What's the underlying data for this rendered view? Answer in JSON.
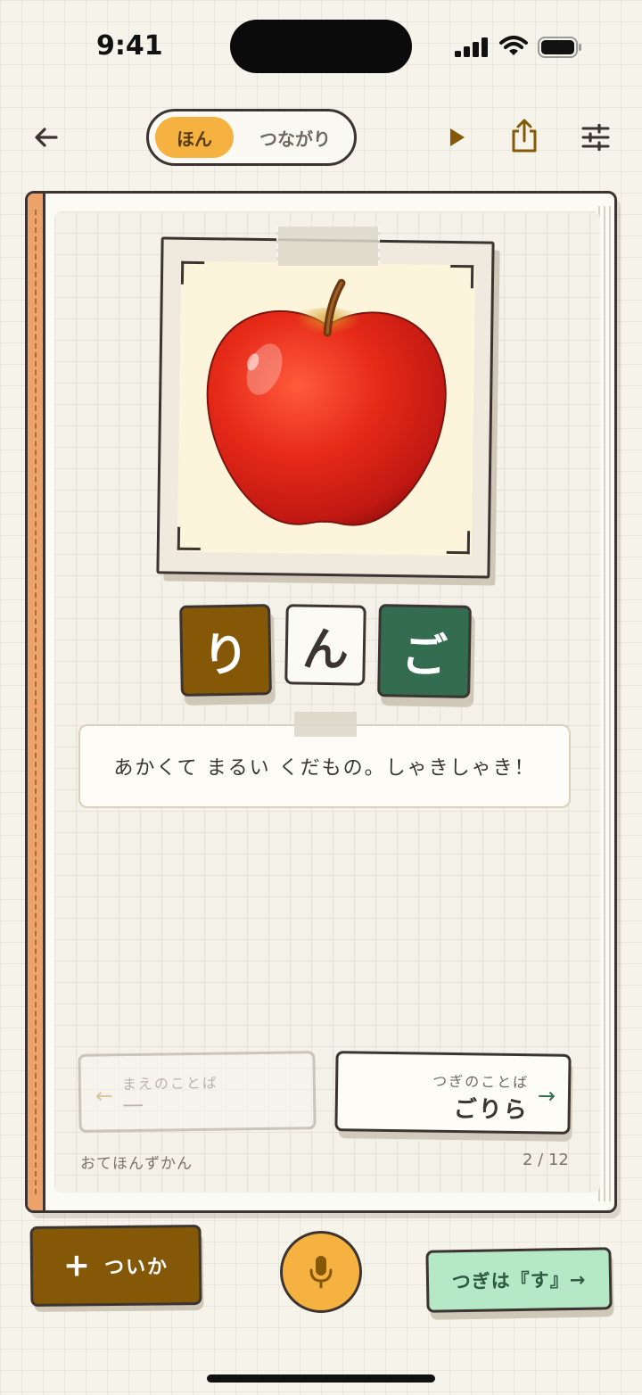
{
  "status_bar": {
    "time": "9:41"
  },
  "header": {
    "segments": [
      {
        "label": "ほん",
        "selected": true
      },
      {
        "label": "つながり",
        "selected": false
      }
    ]
  },
  "card": {
    "kana": [
      "り",
      "ん",
      "ご"
    ],
    "description": "あかくて まるい くだもの。しゃきしゃき！"
  },
  "navigation": {
    "prev_label": "まえのことば",
    "prev_word": "—",
    "next_label": "つぎのことば",
    "next_word": "ごりら"
  },
  "footer": {
    "book_title": "おてほんずかん",
    "page_count": "2 / 12"
  },
  "actions": {
    "add_label": "ついか",
    "next_prompt": "つぎは『す』→"
  },
  "colors": {
    "accent_orange": "#f6b240",
    "brown": "#855808",
    "green": "#336c4e",
    "mint": "#b5e8c7",
    "ink": "#3b3430"
  }
}
